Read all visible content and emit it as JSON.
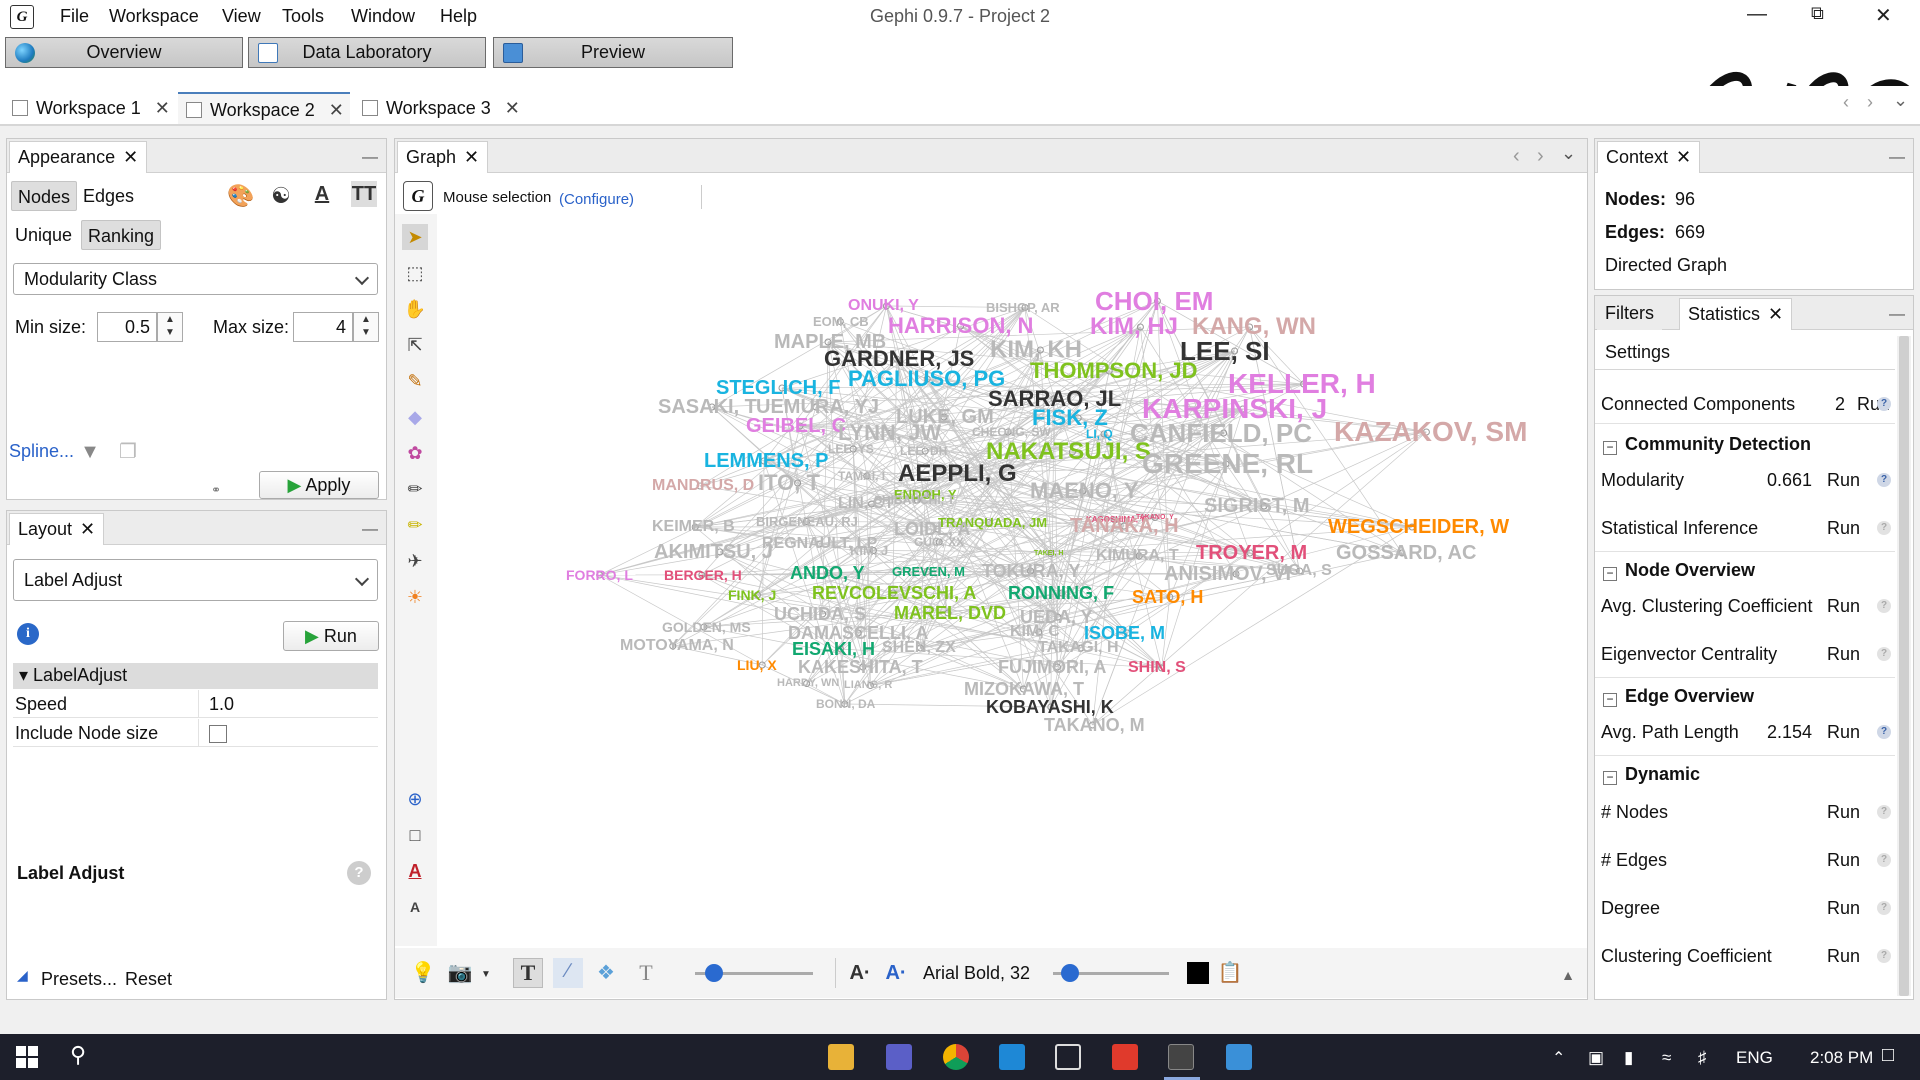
{
  "app": {
    "title": "Gephi 0.9.7 - Project 2"
  },
  "menu": [
    "File",
    "Workspace",
    "View",
    "Tools",
    "Window",
    "Help"
  ],
  "modes": [
    "Overview",
    "Data Laboratory",
    "Preview"
  ],
  "workspaces": [
    {
      "label": "Workspace 1",
      "active": false
    },
    {
      "label": "Workspace 2",
      "active": true
    },
    {
      "label": "Workspace 3",
      "active": false
    }
  ],
  "appearance": {
    "tab": "Appearance",
    "nodes_tab": "Nodes",
    "edges_tab": "Edges",
    "unique": "Unique",
    "ranking": "Ranking",
    "attribute": "Modularity Class",
    "min_size_label": "Min size:",
    "min_size": "0.5",
    "max_size_label": "Max size:",
    "max_size": "4",
    "spline": "Spline...",
    "apply": "Apply"
  },
  "layout": {
    "tab": "Layout",
    "algorithm": "Label Adjust",
    "run": "Run",
    "group": "LabelAdjust",
    "props": [
      {
        "name": "Speed",
        "value": "1.0"
      },
      {
        "name": "Include Node size",
        "value": ""
      }
    ],
    "desc_title": "Label Adjust",
    "presets": "Presets...",
    "reset": "Reset"
  },
  "graph": {
    "tab": "Graph",
    "mode": "Mouse selection",
    "configure": "(Configure)",
    "font": "Arial Bold, 32"
  },
  "context": {
    "tab": "Context",
    "nodes_label": "Nodes:",
    "nodes": "96",
    "edges_label": "Edges:",
    "edges": "669",
    "type": "Directed Graph"
  },
  "statistics": {
    "filters_tab": "Filters",
    "stats_tab": "Statistics",
    "settings": "Settings",
    "run": "Run",
    "top": [
      {
        "name": "Connected Components",
        "value": "2"
      }
    ],
    "sections": [
      {
        "title": "Community Detection",
        "items": [
          {
            "name": "Modularity",
            "value": "0.661"
          },
          {
            "name": "Statistical Inference",
            "value": ""
          }
        ]
      },
      {
        "title": "Node Overview",
        "items": [
          {
            "name": "Avg. Clustering Coefficient",
            "value": ""
          },
          {
            "name": "Eigenvector Centrality",
            "value": ""
          }
        ]
      },
      {
        "title": "Edge Overview",
        "items": [
          {
            "name": "Avg. Path Length",
            "value": "2.154"
          }
        ]
      },
      {
        "title": "Dynamic",
        "items": [
          {
            "name": "# Nodes",
            "value": ""
          },
          {
            "name": "# Edges",
            "value": ""
          },
          {
            "name": "Degree",
            "value": ""
          },
          {
            "name": "Clustering Coefficient",
            "value": ""
          }
        ]
      }
    ]
  },
  "taskbar": {
    "lang": "ENG",
    "time": "2:08 PM"
  },
  "colors": {
    "pink": "#e07ee0",
    "cyan": "#19b4e0",
    "green": "#7fc21e",
    "teal": "#12a870",
    "orange": "#ff8a00",
    "rose": "#e2507a",
    "dark": "#333333",
    "gray": "#b9b9b9",
    "tan": "#d4a8a8"
  },
  "graph_labels": [
    {
      "t": "CHOI, EM",
      "c": "pink",
      "s": 26
    },
    {
      "t": "ONUKI, Y",
      "c": "pink",
      "s": 16
    },
    {
      "t": "BISHOP, AR",
      "c": "gray",
      "s": 13
    },
    {
      "t": "EOM, CB",
      "c": "gray",
      "s": 13
    },
    {
      "t": "HARRISON, N",
      "c": "pink",
      "s": 22
    },
    {
      "t": "KIM, HJ",
      "c": "pink",
      "s": 24
    },
    {
      "t": "KANG, WN",
      "c": "tan",
      "s": 24
    },
    {
      "t": "MAPLE, MB",
      "c": "gray",
      "s": 20
    },
    {
      "t": "GARDNER, JS",
      "c": "dark",
      "s": 22
    },
    {
      "t": "KIM, KH",
      "c": "gray",
      "s": 24
    },
    {
      "t": "LEE, SI",
      "c": "dark",
      "s": 26
    },
    {
      "t": "THOMPSON, JD",
      "c": "green",
      "s": 22
    },
    {
      "t": "PAGLIUSO, PG",
      "c": "cyan",
      "s": 22
    },
    {
      "t": "STEGLICH, F",
      "c": "cyan",
      "s": 20
    },
    {
      "t": "KELLER, H",
      "c": "pink",
      "s": 28
    },
    {
      "t": "SARRAO, JL",
      "c": "dark",
      "s": 22
    },
    {
      "t": "SASAKI, T",
      "c": "gray",
      "s": 20
    },
    {
      "t": "UEMURA, YJ",
      "c": "gray",
      "s": 20
    },
    {
      "t": "LUKE, GM",
      "c": "gray",
      "s": 20
    },
    {
      "t": "FISK, Z",
      "c": "cyan",
      "s": 22
    },
    {
      "t": "KARPINSKI, J",
      "c": "pink",
      "s": 28
    },
    {
      "t": "GEIBEL, C",
      "c": "pink",
      "s": 20
    },
    {
      "t": "LYNN, JW",
      "c": "gray",
      "s": 22
    },
    {
      "t": "CHEONG, SW",
      "c": "gray",
      "s": 12
    },
    {
      "t": "LI, Q",
      "c": "cyan",
      "s": 12
    },
    {
      "t": "CANFIELD, PC",
      "c": "gray",
      "s": 26
    },
    {
      "t": "KAZAKOV, SM",
      "c": "tan",
      "s": 28
    },
    {
      "t": "LEE, YS",
      "c": "gray",
      "s": 12
    },
    {
      "t": "LEE, DH",
      "c": "gray",
      "s": 12
    },
    {
      "t": "NAKATSUJI, S",
      "c": "green",
      "s": 24
    },
    {
      "t": "LEMMENS, P",
      "c": "cyan",
      "s": 20
    },
    {
      "t": "GREENE, RL",
      "c": "gray",
      "s": 28
    },
    {
      "t": "MANDRUS, D",
      "c": "tan",
      "s": 16
    },
    {
      "t": "ITO, T",
      "c": "gray",
      "s": 22
    },
    {
      "t": "TAMAI, I",
      "c": "gray",
      "s": 12
    },
    {
      "t": "AEPPLI, G",
      "c": "dark",
      "s": 24
    },
    {
      "t": "ENDOH, Y",
      "c": "green",
      "s": 13
    },
    {
      "t": "MAENO, Y",
      "c": "gray",
      "s": 22
    },
    {
      "t": "LIN, CT",
      "c": "gray",
      "s": 16
    },
    {
      "t": "SHIBAUCHI, T",
      "c": "gray",
      "s": 12
    },
    {
      "t": "TRANQUADA, JM",
      "c": "green",
      "s": 13
    },
    {
      "t": "KAGOSHIMA, Y",
      "c": "rose",
      "s": 8
    },
    {
      "t": "TAKANO, Y",
      "c": "rose",
      "s": 7
    },
    {
      "t": "SIGRIST, M",
      "c": "gray",
      "s": 20
    },
    {
      "t": "KEIMER, B",
      "c": "gray",
      "s": 16
    },
    {
      "t": "BIRGENEAU, RJ",
      "c": "gray",
      "s": 13
    },
    {
      "t": "LOIDL, A",
      "c": "gray",
      "s": 18
    },
    {
      "t": "TANAKA, H",
      "c": "tan",
      "s": 20
    },
    {
      "t": "WEGSCHEIDER, W",
      "c": "orange",
      "s": 20
    },
    {
      "t": "REGNAULT, LP",
      "c": "gray",
      "s": 16
    },
    {
      "t": "KIM, J",
      "c": "gray",
      "s": 13
    },
    {
      "t": "GUO, XX",
      "c": "gray",
      "s": 12
    },
    {
      "t": "TROYER, M",
      "c": "rose",
      "s": 20
    },
    {
      "t": "GOSSARD, AC",
      "c": "gray",
      "s": 20
    },
    {
      "t": "AKIMITSU, J",
      "c": "gray",
      "s": 20
    },
    {
      "t": "TAKEI, H",
      "c": "green",
      "s": 7
    },
    {
      "t": "KIMURA, T",
      "c": "gray",
      "s": 16
    },
    {
      "t": "GREVEN, M",
      "c": "teal",
      "s": 13
    },
    {
      "t": "SUGA, S",
      "c": "gray",
      "s": 16
    },
    {
      "t": "FORRO, L",
      "c": "pink",
      "s": 14
    },
    {
      "t": "BERGER, H",
      "c": "rose",
      "s": 14
    },
    {
      "t": "ANDO, Y",
      "c": "teal",
      "s": 18
    },
    {
      "t": "TOKURA, Y",
      "c": "gray",
      "s": 18
    },
    {
      "t": "ANISIMOV, VI",
      "c": "gray",
      "s": 20
    },
    {
      "t": "FINK, J",
      "c": "green",
      "s": 14
    },
    {
      "t": "REVCOLEVSCHI, A",
      "c": "green",
      "s": 18
    },
    {
      "t": "RONNING, F",
      "c": "teal",
      "s": 18
    },
    {
      "t": "SATO, H",
      "c": "orange",
      "s": 18
    },
    {
      "t": "UCHIDA, S",
      "c": "gray",
      "s": 18
    },
    {
      "t": "MAREL, DVD",
      "c": "green",
      "s": 18
    },
    {
      "t": "UEDA, Y",
      "c": "gray",
      "s": 18
    },
    {
      "t": "GOLDEN, MS",
      "c": "gray",
      "s": 14
    },
    {
      "t": "DAMASCELLI, A",
      "c": "gray",
      "s": 18
    },
    {
      "t": "KIM, C",
      "c": "gray",
      "s": 16
    },
    {
      "t": "ISOBE, M",
      "c": "cyan",
      "s": 18
    },
    {
      "t": "MOTOYAMA, N",
      "c": "gray",
      "s": 16
    },
    {
      "t": "EISAKI, H",
      "c": "teal",
      "s": 18
    },
    {
      "t": "SHEN, ZX",
      "c": "gray",
      "s": 16
    },
    {
      "t": "TAKAGI, H",
      "c": "gray",
      "s": 16
    },
    {
      "t": "LIU, X",
      "c": "orange",
      "s": 14
    },
    {
      "t": "KAKESHITA, T",
      "c": "gray",
      "s": 18
    },
    {
      "t": "FUJIMORI, A",
      "c": "gray",
      "s": 18
    },
    {
      "t": "SHIN, S",
      "c": "rose",
      "s": 16
    },
    {
      "t": "HARDY, WN",
      "c": "gray",
      "s": 11
    },
    {
      "t": "LIANG, R",
      "c": "gray",
      "s": 11
    },
    {
      "t": "MIZOKAWA, T",
      "c": "gray",
      "s": 18
    },
    {
      "t": "BONN, DA",
      "c": "gray",
      "s": 12
    },
    {
      "t": "KOBAYASHI, K",
      "c": "dark",
      "s": 18
    },
    {
      "t": "TAKANO, M",
      "c": "gray",
      "s": 18
    }
  ]
}
